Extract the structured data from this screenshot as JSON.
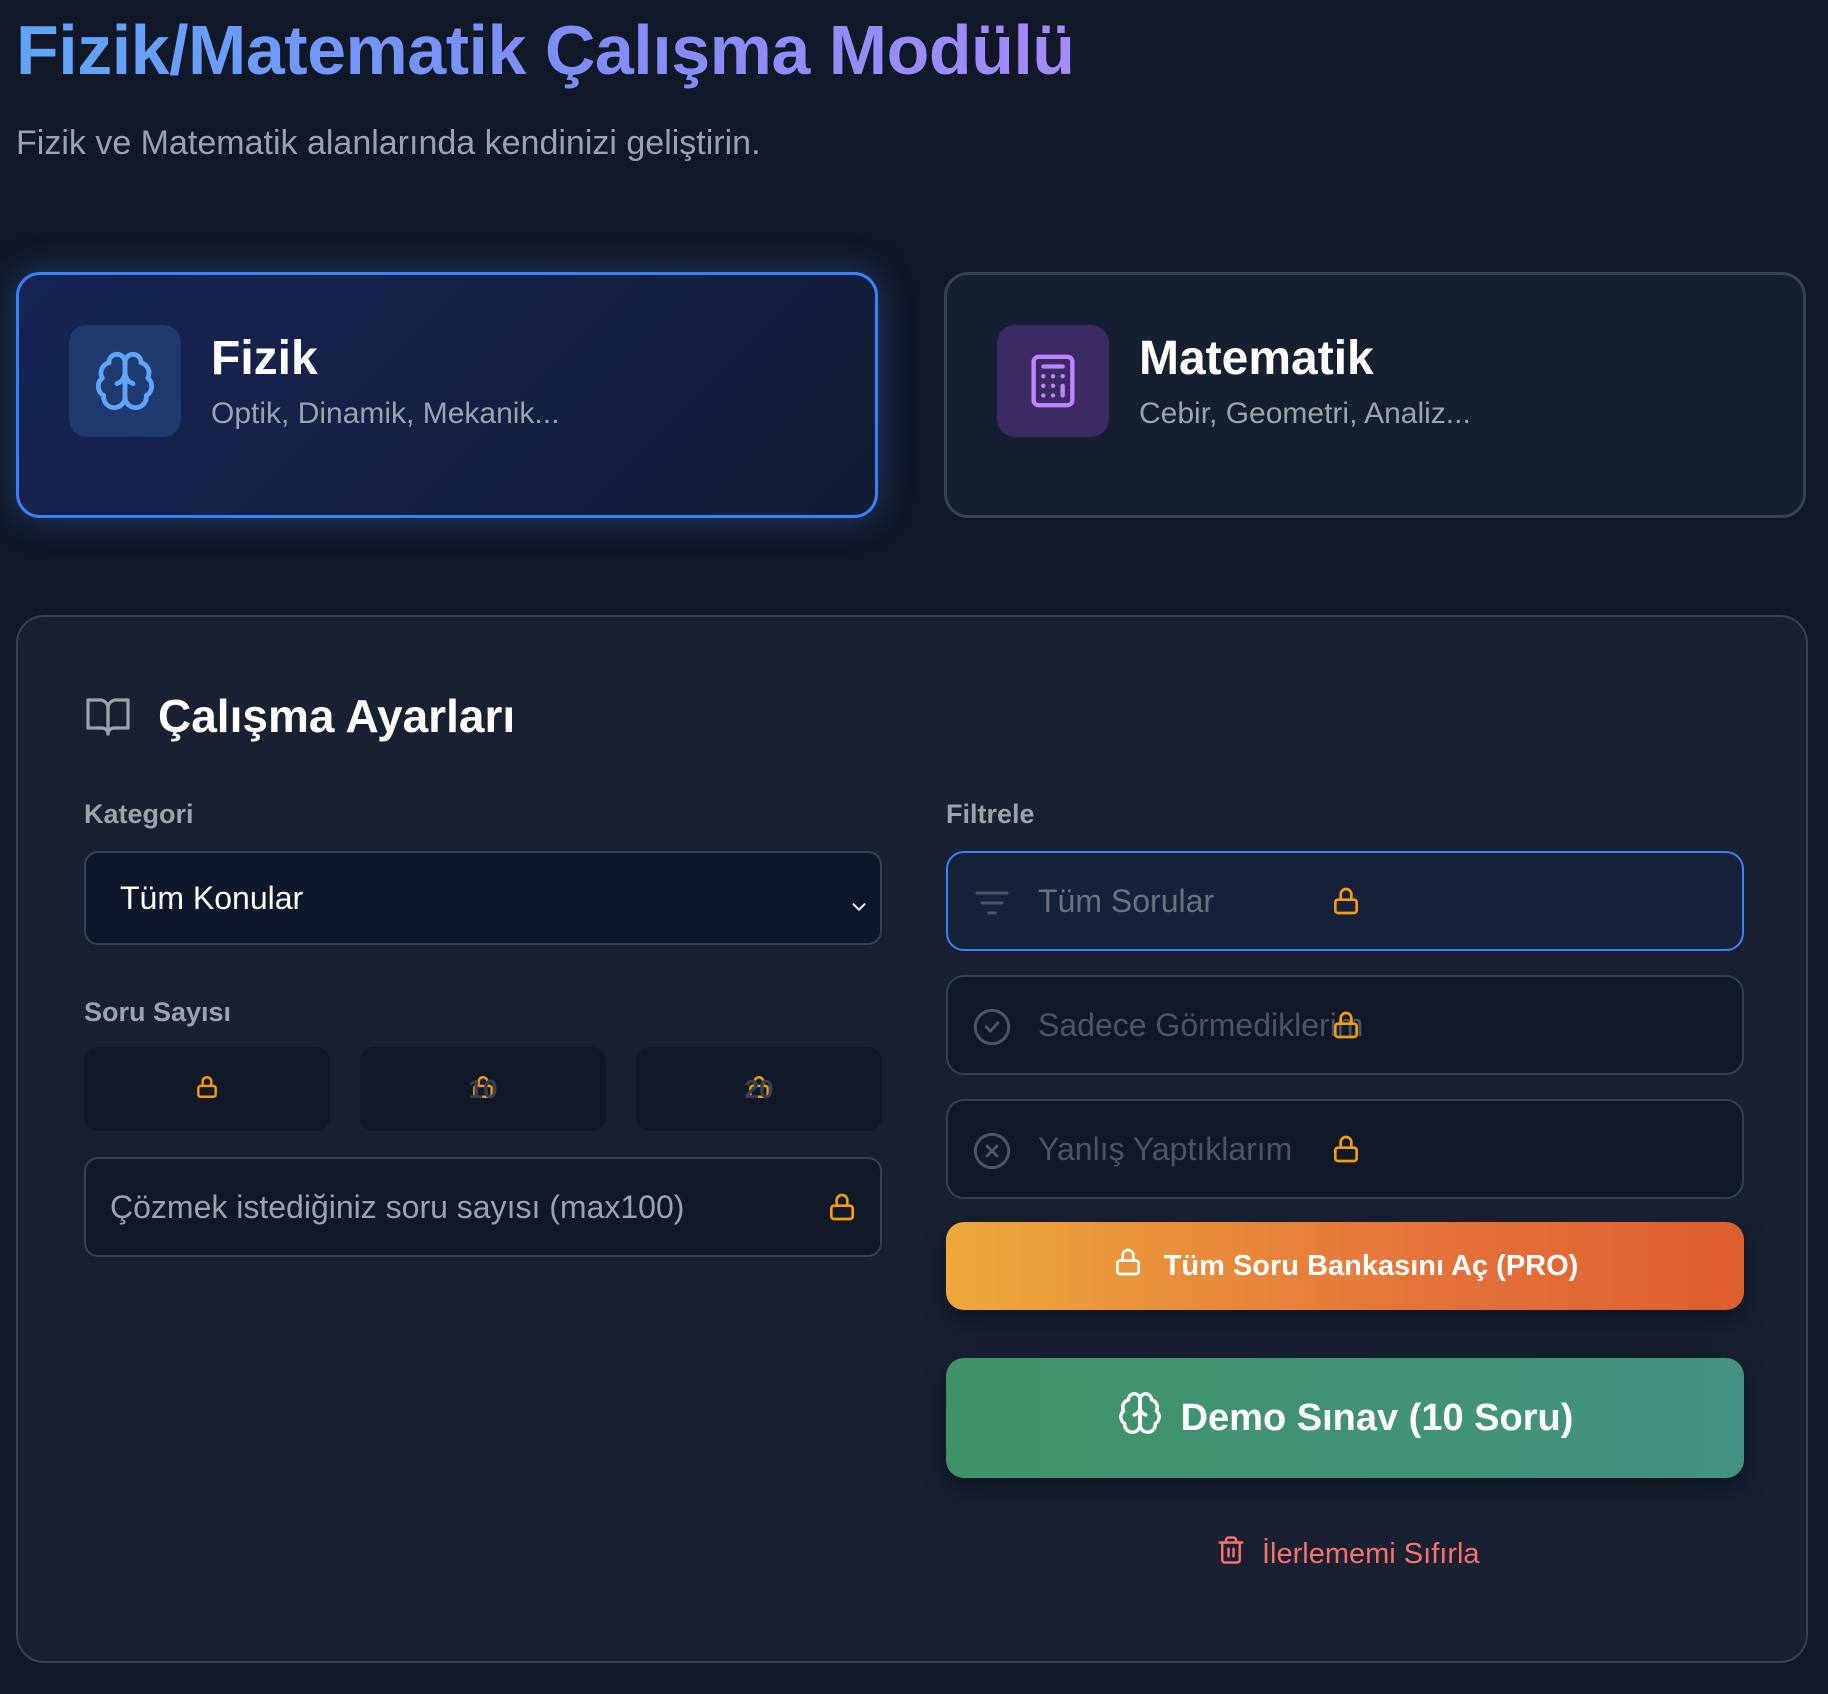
{
  "header": {
    "title": "Fizik/Matematik Çalışma Modülü",
    "subtitle": "Fizik ve Matematik alanlarında kendinizi geliştirin."
  },
  "subjects": [
    {
      "title": "Fizik",
      "description": "Optik, Dinamik, Mekanik...",
      "icon": "brain-icon",
      "selected": true
    },
    {
      "title": "Matematik",
      "description": "Cebir, Geometri, Analiz...",
      "icon": "calculator-icon",
      "selected": false
    }
  ],
  "settings": {
    "title": "Çalışma Ayarları",
    "icon": "book-open-icon",
    "category_label": "Kategori",
    "category_value": "Tüm Konular",
    "count_label": "Soru Sayısı",
    "count_options": [
      "",
      "10",
      "20"
    ],
    "count_placeholder": "Çözmek istediğiniz soru sayısı (max100)",
    "filter_label": "Filtrele",
    "filters": [
      {
        "label": "Tüm Sorular",
        "icon": "filter-icon",
        "active": true
      },
      {
        "label": "Sadece Görmediklerim",
        "icon": "check-circle-icon",
        "active": false
      },
      {
        "label": "Yanlış Yaptıklarım",
        "icon": "x-circle-icon",
        "active": false
      }
    ],
    "pro_button": "Tüm Soru Bankasını Aç (PRO)",
    "demo_button": "Demo Sınav (10 Soru)",
    "reset_link": "İlerlememi Sıfırla"
  },
  "colors": {
    "background": "#111827",
    "accent_blue": "#3b82f6",
    "lock": "#f59e0b",
    "pro_gradient_start": "#eda93c",
    "pro_gradient_end": "#dd5f2e",
    "demo_green": "#3f9366",
    "danger": "#f87171"
  }
}
